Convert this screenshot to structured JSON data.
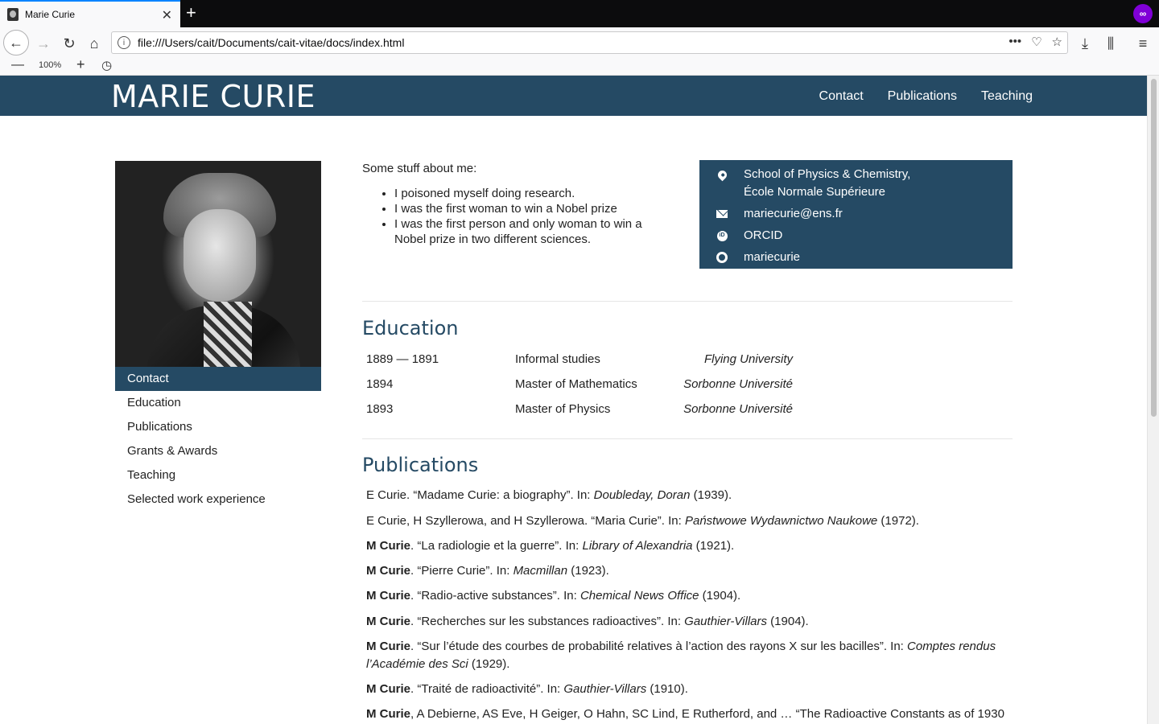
{
  "browser": {
    "tab_title": "Marie Curie",
    "url": "file:///Users/cait/Documents/cait-vitae/docs/index.html",
    "zoom": "100%"
  },
  "site": {
    "title": "MARIE CURIE",
    "nav": [
      "Contact",
      "Publications",
      "Teaching"
    ]
  },
  "sidebar": {
    "items": [
      "Contact",
      "Education",
      "Publications",
      "Grants & Awards",
      "Teaching",
      "Selected work experience"
    ],
    "active": "Contact"
  },
  "about": {
    "intro": "Some stuff about me:",
    "points": [
      "I poisoned myself doing research.",
      "I was the first woman to win a Nobel prize",
      "I was the first person and only woman to win a Nobel prize in two different sciences."
    ]
  },
  "contact": {
    "address_line1": "School of Physics & Chemistry,",
    "address_line2": "École Normale Supérieure",
    "email": "mariecurie@ens.fr",
    "orcid": "ORCID",
    "github": "mariecurie"
  },
  "education": {
    "title": "Education",
    "rows": [
      {
        "date": "1889 — 1891",
        "degree": "Informal studies",
        "institution": "Flying University"
      },
      {
        "date": "1894",
        "degree": "Master of Mathematics",
        "institution": "Sorbonne Université"
      },
      {
        "date": "1893",
        "degree": "Master of Physics",
        "institution": "Sorbonne Université"
      }
    ]
  },
  "publications": {
    "title": "Publications",
    "items": [
      {
        "authors": "E Curie",
        "bold": "",
        "title": "“Madame Curie: a biography”. In: ",
        "venue": "Doubleday, Doran",
        "year": " (1939)."
      },
      {
        "authors": "E Curie, H Szyllerowa, and H Szyllerowa",
        "bold": "",
        "title": "“Maria Curie”. In: ",
        "venue": "Państwowe Wydawnictwo Naukowe",
        "year": " (1972)."
      },
      {
        "authors": "",
        "bold": "M Curie",
        "title": "“La radiologie et la guerre”. In: ",
        "venue": "Library of Alexandria",
        "year": " (1921)."
      },
      {
        "authors": "",
        "bold": "M Curie",
        "title": "“Pierre Curie”. In: ",
        "venue": "Macmillan",
        "year": " (1923)."
      },
      {
        "authors": "",
        "bold": "M Curie",
        "title": "“Radio-active substances”. In: ",
        "venue": "Chemical News Office",
        "year": " (1904)."
      },
      {
        "authors": "",
        "bold": "M Curie",
        "title": "“Recherches sur les substances radioactives”. In: ",
        "venue": "Gauthier-Villars",
        "year": " (1904)."
      },
      {
        "authors": "",
        "bold": "M Curie",
        "title": "“Sur l’étude des courbes de probabilité relatives à l’action des rayons X sur les bacilles”. In: ",
        "venue": "Comptes rendus l’Académie des Sci",
        "year": " (1929)."
      },
      {
        "authors": "",
        "bold": "M Curie",
        "title": "“Traité de radioactivité”. In: ",
        "venue": "Gauthier-Villars",
        "year": " (1910)."
      },
      {
        "authors": ", A Debierne, AS Eve, H Geiger, O Hahn, SC Lind, E Rutherford, and … “The Radioactive Constants as of 1930",
        "bold": "M Curie",
        "title": "",
        "venue": "",
        "year": ""
      }
    ]
  }
}
